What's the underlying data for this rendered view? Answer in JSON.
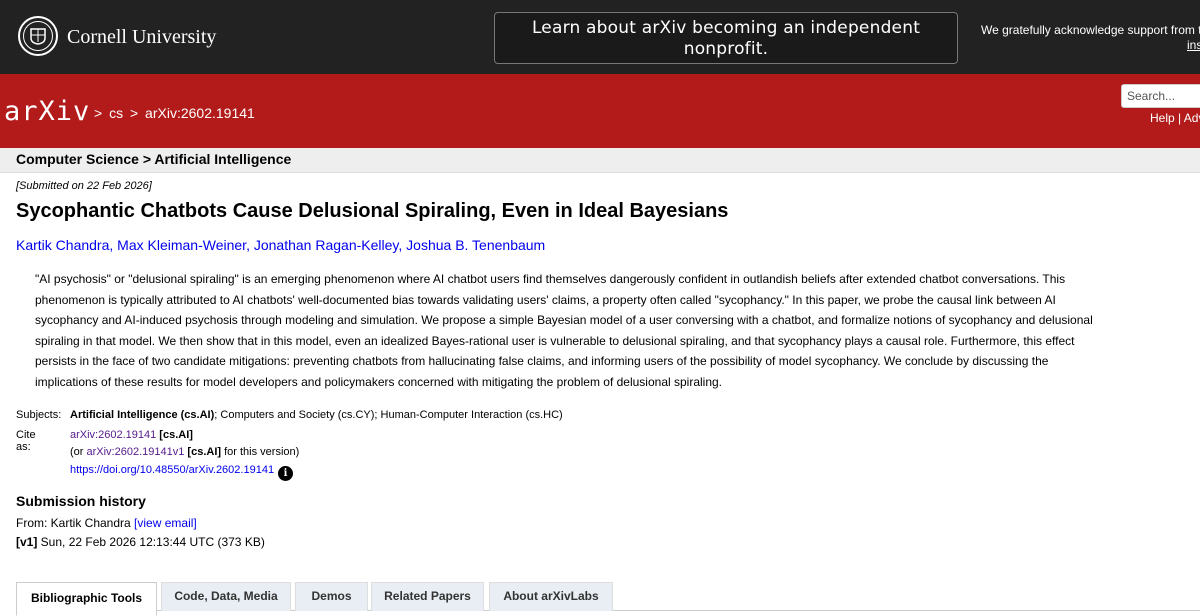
{
  "top": {
    "university": "Cornell University",
    "announcement": "Learn about arXiv becoming an independent nonprofit.",
    "support_text": "We gratefully acknowledge support from the",
    "support_link": "ins"
  },
  "header": {
    "logo_text": "arXiv",
    "breadcrumb": [
      ">",
      "cs",
      ">",
      "arXiv:2602.19141"
    ],
    "search_placeholder": "Search...",
    "help": "Help | Adv"
  },
  "subheader": "Computer Science > Artificial Intelligence",
  "paper": {
    "submitted": "[Submitted on 22 Feb 2026]",
    "title": "Sycophantic Chatbots Cause Delusional Spiraling, Even in Ideal Bayesians",
    "authors": [
      "Kartik Chandra",
      "Max Kleiman-Weiner",
      "Jonathan Ragan-Kelley",
      "Joshua B. Tenenbaum"
    ],
    "abstract_lines": [
      "\"AI psychosis\" or \"delusional spiraling\" is an emerging phenomenon where AI chatbot users find themselves dangerously confident in outlandish beliefs after extended chatbot conversations. This",
      "phenomenon is typically attributed to AI chatbots' well-documented bias towards validating users' claims, a property often called \"sycophancy.\" In this paper, we probe the causal link between AI",
      "sycophancy and AI-induced psychosis through modeling and simulation. We propose a simple Bayesian model of a user conversing with a chatbot, and formalize notions of sycophancy and delusional",
      "spiraling in that model. We then show that in this model, even an idealized Bayes-rational user is vulnerable to delusional spiraling, and that sycophancy plays a causal role. Furthermore, this effect",
      "persists in the face of two candidate mitigations: preventing chatbots from hallucinating false claims, and informing users of the possibility of model sycophancy. We conclude by discussing the",
      "implications of these results for model developers and policymakers concerned with mitigating the problem of delusional spiraling."
    ]
  },
  "meta": {
    "subjects_label": "Subjects:",
    "subjects_primary": "Artificial Intelligence (cs.AI)",
    "subjects_rest": "; Computers and Society (cs.CY); Human-Computer Interaction (cs.HC)",
    "cite_label": "Cite as:",
    "cite_id": "arXiv:2602.19141",
    "cite_cat": "[cs.AI]",
    "or_prefix": "(or ",
    "or_id": "arXiv:2602.19141v1",
    "or_cat": "[cs.AI]",
    "or_suffix": " for this version)",
    "doi": "https://doi.org/10.48550/arXiv.2602.19141"
  },
  "history": {
    "title": "Submission history",
    "from_prefix": "From: Kartik Chandra ",
    "view_email": "[view email]",
    "v1_label": "[v1]",
    "v1_text": " Sun, 22 Feb 2026 12:13:44 UTC (373 KB)"
  },
  "tabs": [
    "Bibliographic Tools",
    "Code, Data, Media",
    "Demos",
    "Related Papers",
    "About arXivLabs"
  ]
}
